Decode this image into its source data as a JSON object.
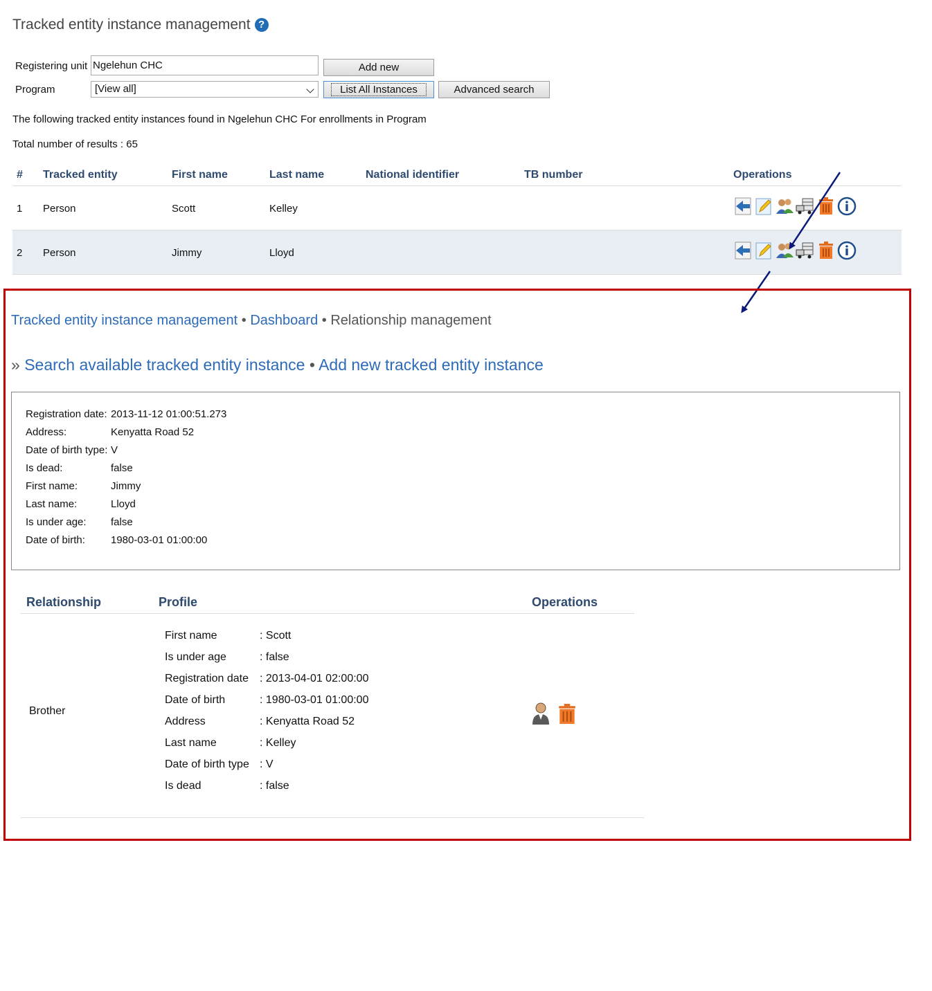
{
  "header": {
    "title": "Tracked entity instance management",
    "help_icon": "question-circle-icon"
  },
  "form": {
    "registering_unit_label": "Registering unit",
    "registering_unit_value": "Ngelehun CHC",
    "program_label": "Program",
    "program_selected": "[View all]",
    "add_new_label": "Add new",
    "list_all_label": "List All Instances",
    "advanced_search_label": "Advanced search"
  },
  "results": {
    "summary": "The following tracked entity instances found in Ngelehun CHC For enrollments in Program",
    "total": "Total number of results : 65"
  },
  "table": {
    "headers": [
      "#",
      "Tracked entity",
      "First name",
      "Last name",
      "National identifier",
      "TB number",
      "Operations"
    ],
    "rows": [
      {
        "num": "1",
        "entity": "Person",
        "first": "Scott",
        "last": "Kelley",
        "national_id": "",
        "tb": ""
      },
      {
        "num": "2",
        "entity": "Person",
        "first": "Jimmy",
        "last": "Lloyd",
        "national_id": "",
        "tb": ""
      }
    ],
    "operation_icons": [
      "dashboard-arrow-icon",
      "edit-pencil-icon",
      "relationship-people-icon",
      "transfer-truck-icon",
      "delete-trash-icon",
      "info-icon"
    ]
  },
  "relationship_panel": {
    "breadcrumb": {
      "item1": "Tracked entity instance management",
      "sep": "•",
      "item2": "Dashboard",
      "item3": "Relationship management"
    },
    "links": {
      "prefix": "»",
      "search": "Search available tracked entity instance",
      "sep": "•",
      "add": "Add new tracked entity instance"
    },
    "details": [
      {
        "label": "Registration date:",
        "value": "2013-11-12 01:00:51.273"
      },
      {
        "label": "Address:",
        "value": "Kenyatta Road 52"
      },
      {
        "label": "Date of birth type:",
        "value": "V"
      },
      {
        "label": "Is dead:",
        "value": "false"
      },
      {
        "label": "First name:",
        "value": "Jimmy"
      },
      {
        "label": "Last name:",
        "value": "Lloyd"
      },
      {
        "label": "Is under age:",
        "value": "false"
      },
      {
        "label": "Date of birth:",
        "value": "1980-03-01 01:00:00"
      }
    ],
    "rel_headers": {
      "relationship": "Relationship",
      "profile": "Profile",
      "operations": "Operations"
    },
    "relationship": {
      "type": "Brother",
      "profile": [
        {
          "label": "First name",
          "value": ": Scott"
        },
        {
          "label": "Is under age",
          "value": ": false"
        },
        {
          "label": "Registration date",
          "value": ": 2013-04-01 02:00:00"
        },
        {
          "label": "Date of birth",
          "value": ": 1980-03-01 01:00:00"
        },
        {
          "label": "Address",
          "value": ": Kenyatta Road 52"
        },
        {
          "label": "Last name",
          "value": ": Kelley"
        },
        {
          "label": "Date of birth type",
          "value": ": V"
        },
        {
          "label": "Is dead",
          "value": ": false"
        }
      ],
      "operation_icons": [
        "person-profile-icon",
        "delete-trash-icon"
      ]
    }
  },
  "colors": {
    "link": "#2d6bb8",
    "header_text": "#2e4a6e",
    "frame": "#c00000",
    "arrow": "#0b1a7a",
    "row_highlight": "#e9eef5"
  }
}
